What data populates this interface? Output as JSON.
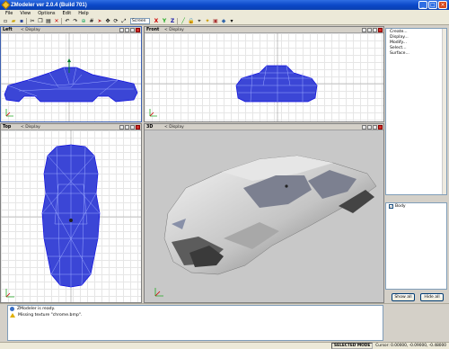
{
  "window": {
    "title": "ZModeler ver 2.0.4 (Build 701)"
  },
  "menu": [
    "File",
    "View",
    "Options",
    "Edit",
    "Help"
  ],
  "toolbar": {
    "screen_select": "Screen"
  },
  "viewports": {
    "left": {
      "name": "Left",
      "display": "< Display"
    },
    "front": {
      "name": "Front",
      "display": "< Display"
    },
    "top": {
      "name": "Top",
      "display": "< Display"
    },
    "persp": {
      "name": "3D",
      "display": "< Display"
    }
  },
  "commands": [
    "Create...",
    "Display...",
    "Modify...",
    "Select...",
    "Surface..."
  ],
  "layers": [
    {
      "name": "Body",
      "checked": true
    }
  ],
  "buttons": {
    "show_all": "Show all",
    "hide_all": "Hide all"
  },
  "log": [
    {
      "type": "info",
      "text": "ZModeler is ready."
    },
    {
      "type": "warning",
      "text": "Missing texture \"chrome.bmp\"."
    }
  ],
  "status": {
    "mode": "SELECTED MODE",
    "cursor": "Cursor: 0.00000, -0.09000, -0.48000"
  },
  "colors": {
    "wire": "#1010e0",
    "wire_fill": "#3b46d6",
    "titlebar": "#0b49c9"
  }
}
